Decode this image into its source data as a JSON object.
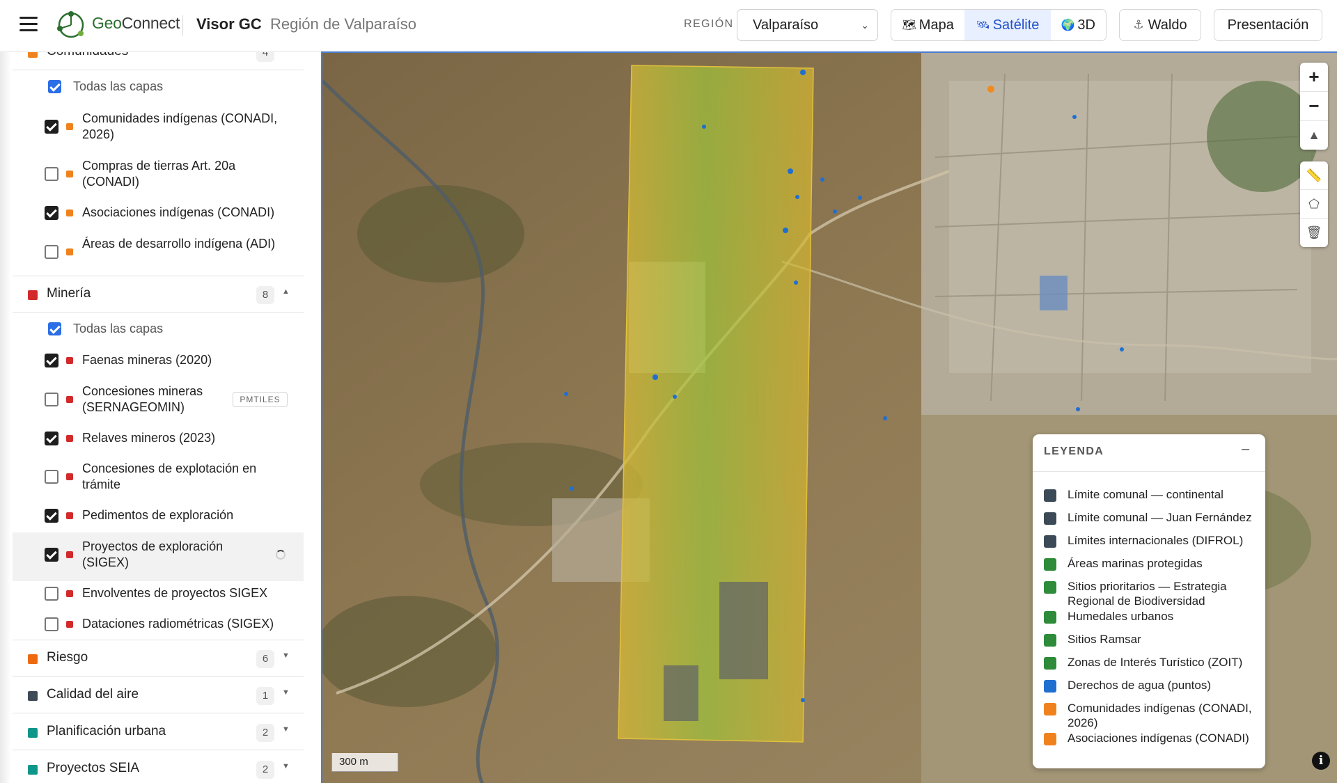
{
  "header": {
    "logo_text_a": "Geo",
    "logo_text_b": "Connect",
    "title": "Visor GC",
    "subtitle": "Región de Valparaíso",
    "region_label": "REGIÓN",
    "region_value": "Valparaíso",
    "view_map": "Mapa",
    "view_sat": "Satélite",
    "view_3d": "3D",
    "waldo": "Waldo",
    "presentation": "Presentación"
  },
  "colors": {
    "accent": "#2b6ee6",
    "comunidades": "#f0821e",
    "mineria": "#d22a2a",
    "riesgo": "#ee6a10",
    "calidad_aire": "#3e4b57",
    "planificacion": "#0f968a",
    "seia": "#0f968a"
  },
  "sidebar": {
    "comunidades": {
      "name": "Comunidades",
      "count": "4"
    },
    "comunidades_all": "Todas las capas",
    "comunidades_layers": [
      {
        "label": "Comunidades indígenas (CONADI, 2026)",
        "checked": true
      },
      {
        "label": "Compras de tierras Art. 20a (CONADI)",
        "checked": false
      },
      {
        "label": "Asociaciones indígenas (CONADI)",
        "checked": true
      },
      {
        "label": "Áreas de desarrollo indígena (ADI)",
        "checked": false
      }
    ],
    "mineria": {
      "name": "Minería",
      "count": "8"
    },
    "mineria_all": "Todas las capas",
    "mineria_layers": [
      {
        "label": "Faenas mineras (2020)",
        "checked": true
      },
      {
        "label": "Concesiones mineras (SERNAGEOMIN)",
        "checked": false,
        "badge": "PMTILES"
      },
      {
        "label": "Relaves mineros (2023)",
        "checked": true
      },
      {
        "label": "Concesiones de explotación en trámite",
        "checked": false
      },
      {
        "label": "Pedimentos de exploración",
        "checked": true
      },
      {
        "label": "Proyectos de exploración (SIGEX)",
        "checked": true
      },
      {
        "label": "Envolventes de proyectos SIGEX",
        "checked": false
      },
      {
        "label": "Dataciones radiométricas (SIGEX)",
        "checked": false
      }
    ],
    "riesgo": {
      "name": "Riesgo",
      "count": "6"
    },
    "calidad": {
      "name": "Calidad del aire",
      "count": "1"
    },
    "planificacion": {
      "name": "Planificación urbana",
      "count": "2"
    },
    "seia": {
      "name": "Proyectos SEIA",
      "count": "2"
    }
  },
  "map": {
    "scale": "300 m",
    "controls": [
      "zoom-in",
      "zoom-out",
      "compass",
      "ruler",
      "polygon",
      "trash"
    ]
  },
  "legend": {
    "title": "LEYENDA",
    "items": [
      {
        "label": "Límite comunal — continental",
        "color": "#3b4a56"
      },
      {
        "label": "Límite comunal — Juan Fernández",
        "color": "#3b4a56"
      },
      {
        "label": "Límites internacionales (DIFROL)",
        "color": "#3b4a56"
      },
      {
        "label": "Áreas marinas protegidas",
        "color": "#2e8b3a"
      },
      {
        "label": "Sitios prioritarios — Estrategia Regional de Biodiversidad",
        "color": "#2e8b3a"
      },
      {
        "label": "Humedales urbanos",
        "color": "#2e8b3a"
      },
      {
        "label": "Sitios Ramsar",
        "color": "#2e8b3a"
      },
      {
        "label": "Zonas de Interés Turístico (ZOIT)",
        "color": "#2e8b3a"
      },
      {
        "label": "Derechos de agua (puntos)",
        "color": "#1f6fd1"
      },
      {
        "label": "Comunidades indígenas (CONADI, 2026)",
        "color": "#f0821e"
      },
      {
        "label": "Asociaciones indígenas (CONADI)",
        "color": "#f0821e"
      }
    ]
  }
}
